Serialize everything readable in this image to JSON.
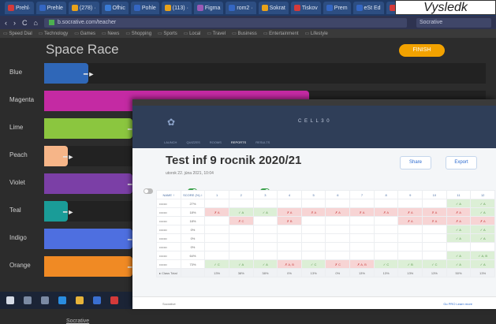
{
  "browser": {
    "tabs": [
      {
        "label": "Prehl·",
        "color": "#d43a3a"
      },
      {
        "label": "Prehle",
        "color": "#3466c2"
      },
      {
        "label": "(278) ·",
        "color": "#e8a21a"
      },
      {
        "label": "Ofhic",
        "color": "#3a7bd5"
      },
      {
        "label": "Pohle",
        "color": "#3466c2"
      },
      {
        "label": "(113) ·",
        "color": "#e8a21a"
      },
      {
        "label": "Figma",
        "color": "#9b59b6"
      },
      {
        "label": "rom2 ·",
        "color": "#3466c2"
      },
      {
        "label": "Sokrat",
        "color": "#e8a21a"
      },
      {
        "label": "Tiskov",
        "color": "#d43a3a"
      },
      {
        "label": "Prem",
        "color": "#3466c2"
      },
      {
        "label": "eSt Ed",
        "color": "#3466c2"
      },
      {
        "label": "Hrene",
        "color": "#d43a3a"
      }
    ],
    "overlay_label": "Vysledk",
    "address": "b.socrative.com/teacher",
    "search_engine": "Socrative",
    "bookmarks": [
      "Speed Dial",
      "Technology",
      "Games",
      "News",
      "Shopping",
      "Sports",
      "Local",
      "Travel",
      "Business",
      "Entertainment",
      "Lifestyle"
    ]
  },
  "race": {
    "title": "Space Race",
    "finish_label": "FINISH",
    "footer": "Socrative",
    "lanes": [
      {
        "label": "Blue",
        "color": "#2f67b8",
        "progress": 0.1
      },
      {
        "label": "Magenta",
        "color": "#c42aa3",
        "progress": 0.6
      },
      {
        "label": "Lime",
        "color": "#8bc63f",
        "progress": 0.2
      },
      {
        "label": "Peach",
        "color": "#f6b588",
        "progress": 0.04
      },
      {
        "label": "Violet",
        "color": "#7b3fa6",
        "progress": 0.2
      },
      {
        "label": "Teal",
        "color": "#1a9c98",
        "progress": 0.04
      },
      {
        "label": "Indigo",
        "color": "#4e6fe0",
        "progress": 0.2
      },
      {
        "label": "Orange",
        "color": "#f08a24",
        "progress": 0.2
      }
    ]
  },
  "window": {
    "room": "C E L L 3 0",
    "nav": [
      "LAUNCH",
      "QUIZZES",
      "ROOMS",
      "REPORTS",
      "RESULTS"
    ],
    "active_nav": "REPORTS",
    "title": "Test inf 9 rocnik 2020/21",
    "date": "utorok 22. júna 2021, 10:04",
    "share_label": "Share",
    "export_label": "Export",
    "toggles": [
      {
        "label": "Show Names",
        "on": false
      },
      {
        "label": "Show Responses",
        "on": true
      },
      {
        "label": "Show Results",
        "on": true
      }
    ],
    "table": {
      "headers": [
        "NAME ↑",
        "SCORE (%) ↕",
        "1",
        "2",
        "3",
        "4",
        "5",
        "6",
        "7",
        "8",
        "9",
        "10",
        "11",
        "12"
      ],
      "rows": [
        {
          "name": "•••••••",
          "score": "27%",
          "cells": [
            "",
            "",
            "",
            "",
            "",
            "",
            "",
            "",
            "",
            "",
            "✓ A",
            "✓ A"
          ]
        },
        {
          "name": "•••••••",
          "score": "18%",
          "cells": [
            "✗ A",
            "✓ A",
            "✓ A",
            "✗ A",
            "✗ A",
            "✗ A",
            "✗ A",
            "✗ A",
            "✗ A",
            "✗ A",
            "✗ A",
            "✓ A"
          ]
        },
        {
          "name": "•••••••",
          "score": "18%",
          "cells": [
            "",
            "✗ C",
            "",
            "✗ B",
            "",
            "",
            "",
            "",
            "✗ A",
            "✗ A",
            "✗ A",
            "✗ A"
          ]
        },
        {
          "name": "•••••••",
          "score": "0%",
          "cells": [
            "",
            "",
            "",
            "",
            "",
            "",
            "",
            "",
            "",
            "",
            "✓ A",
            "✓ A"
          ]
        },
        {
          "name": "•••••••",
          "score": "0%",
          "cells": [
            "",
            "",
            "",
            "",
            "",
            "",
            "",
            "",
            "",
            "",
            "✓ A",
            "✓ A"
          ]
        },
        {
          "name": "•••••••",
          "score": "0%",
          "cells": [
            "",
            "",
            "",
            "",
            "",
            "",
            "",
            "",
            "",
            "",
            "",
            ""
          ]
        },
        {
          "name": "•••••••",
          "score": "64%",
          "cells": [
            "",
            "",
            "",
            "",
            "",
            "",
            "",
            "",
            "",
            "",
            "✓ A",
            "✓ A, B"
          ]
        },
        {
          "name": "•••••••",
          "score": "73%",
          "cells": [
            "✓ C",
            "✓ A",
            "✓ A",
            "✗ A, B",
            "✓ C",
            "✗ C",
            "✗ A, B",
            "✓ C",
            "✓ B",
            "✓ C",
            "✓ A",
            "✓ A"
          ]
        }
      ],
      "total": {
        "label": "▸ Class Total",
        "score": "",
        "cells": [
          "13%",
          "38%",
          "38%",
          "0%",
          "13%",
          "0%",
          "13%",
          "13%",
          "13%",
          "13%",
          "50%",
          "13%"
        ]
      }
    },
    "footer_left": "Socrative",
    "footer_right": "Go PRO  Learn more"
  }
}
